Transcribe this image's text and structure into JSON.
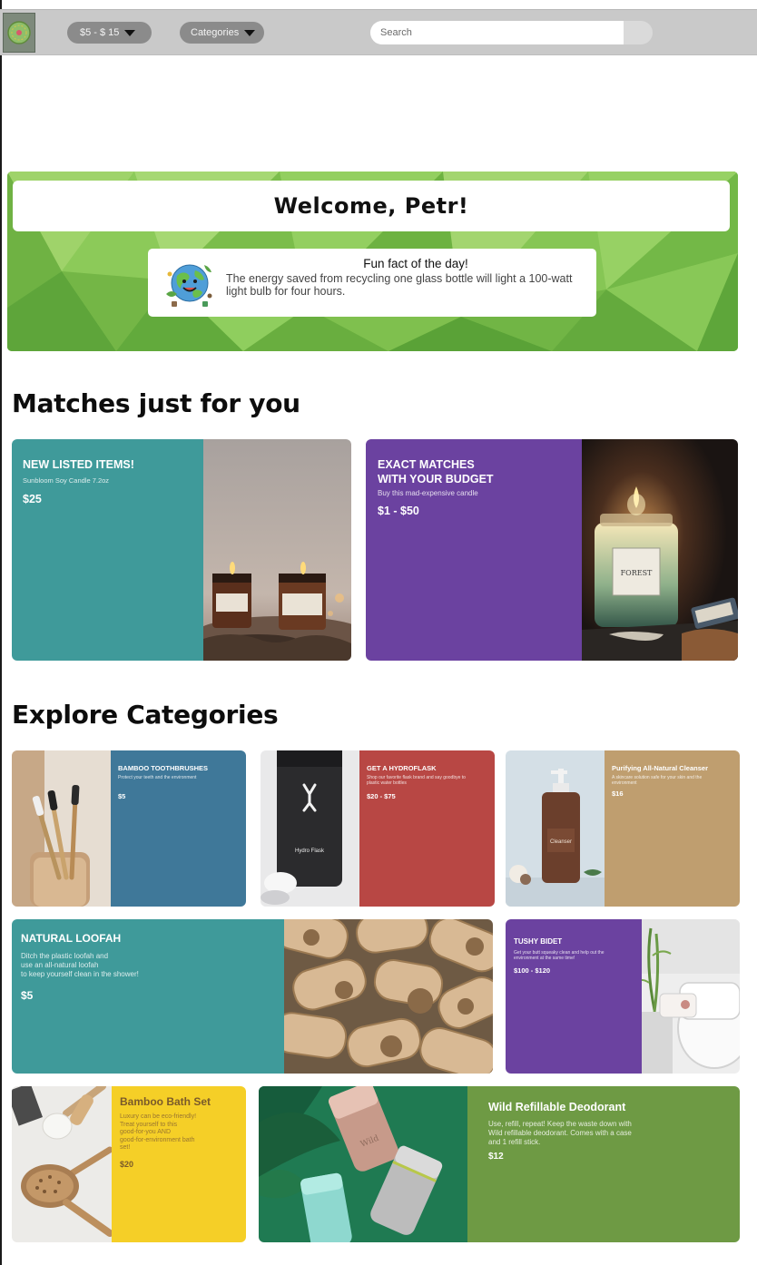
{
  "colors": {
    "topbar": "#c9c9c9",
    "pill": "#8b8b8b",
    "hero_green": "#7fc04f",
    "teal": "#3f9a9a",
    "purple": "#6b42a0",
    "steel_blue": "#3f7899",
    "brick_red": "#b84744",
    "tan": "#bf9e6f",
    "yellow": "#f5cf27",
    "olive_green": "#6e9a44"
  },
  "topbar": {
    "logo_icon": "planet-logo-icon",
    "price_filter": {
      "label": "$5 - $ 15",
      "icon": "caret-down-icon"
    },
    "categories_filter": {
      "label": "Categories",
      "icon": "caret-down-icon"
    },
    "search": {
      "placeholder": "Search"
    }
  },
  "hero": {
    "welcome": "Welcome, Petr!",
    "fun_fact": {
      "icon": "smiling-earth-icon",
      "title": "Fun fact of the day!",
      "body": "The energy saved from recycling one glass bottle will light a 100-watt light bulb for four hours."
    }
  },
  "matches": {
    "heading": "Matches just for you",
    "cards": [
      {
        "title": "NEW LISTED ITEMS!",
        "desc": "Sunbloom Soy Candle 7.2oz",
        "price": "$25",
        "image": "two-candles-photo"
      },
      {
        "title": "EXACT MATCHES WITH YOUR BUDGET",
        "title_line1": "EXACT MATCHES",
        "title_line2": "WITH YOUR BUDGET",
        "desc": "Buy this mad-expensive candle",
        "price": "$1 - $50",
        "image": "forest-candle-photo",
        "candle_label": "FOREST"
      }
    ]
  },
  "explore": {
    "heading": "Explore Categories",
    "cards": [
      {
        "title": "BAMBOO TOOTHBRUSHES",
        "desc": "Protect your teeth and the environment",
        "price": "$5",
        "image": "bamboo-toothbrushes-photo"
      },
      {
        "title": "GET A HYDROFLASK",
        "desc": "Shop our favorite flask brand and say goodbye to plastic water bottles",
        "price": "$20 - $75",
        "image": "hydroflask-photo",
        "bottle_label": "Hydro Flask"
      },
      {
        "title": "Purifying All-Natural Cleanser",
        "desc": "A skincare solution safe for your skin and the environment",
        "price": "$16",
        "image": "cleanser-bottle-photo",
        "bottle_label": "Cleanser"
      },
      {
        "title": "NATURAL LOOFAH",
        "desc_lines": [
          "Ditch the plastic loofah and",
          "use an all-natural loofah",
          "to keep yourself clean in the shower!"
        ],
        "price": "$5",
        "image": "loofah-photo"
      },
      {
        "title": "TUSHY BIDET",
        "desc": "Get your butt squeaky clean and help out the environment at the same time!",
        "price": "$100 - $120",
        "image": "bidet-photo"
      },
      {
        "title": "Bamboo Bath Set",
        "desc_lines": [
          "Luxury can be eco-friendly!",
          "Treat yourself to this",
          "good-for-you AND",
          "good-for-environment bath",
          "set!"
        ],
        "price": "$20",
        "image": "bath-brushes-photo"
      },
      {
        "title": "Wild Refillable Deodorant",
        "desc_lines": [
          "Use, refill, repeat! Keep the waste down with",
          "Wild refillable deodorant. Comes with a case",
          "and 1 refill stick."
        ],
        "price": "$12",
        "image": "deodorant-cases-photo",
        "brand_label": "Wild"
      }
    ]
  }
}
